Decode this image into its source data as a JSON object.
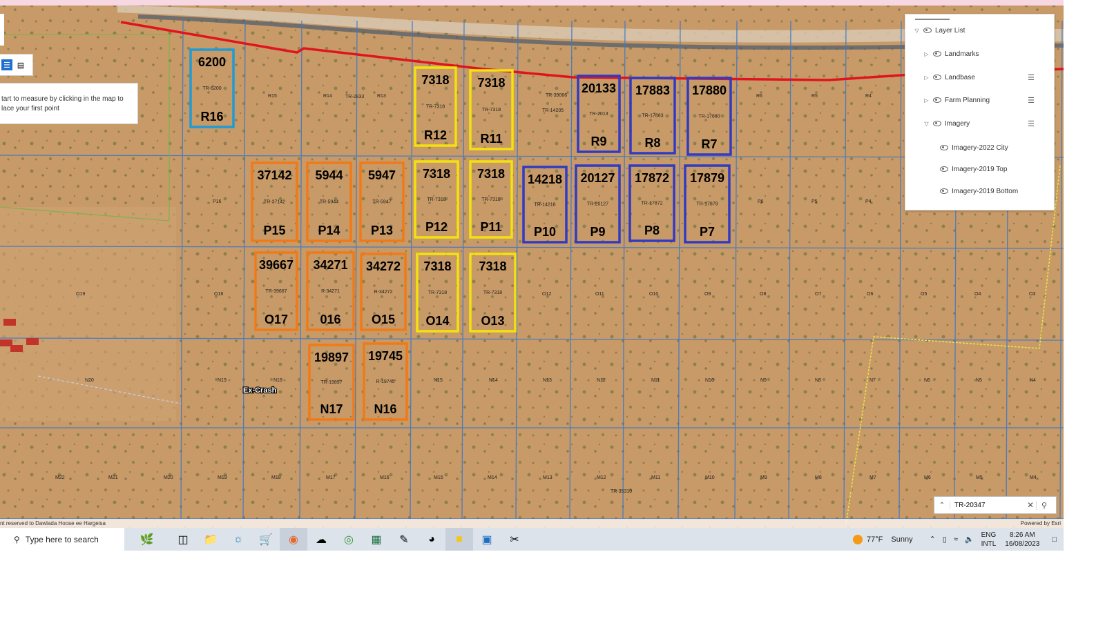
{
  "measure": {
    "hint": "tart to measure by clicking in the map to lace your first point"
  },
  "layer_list": {
    "title": "Layer List",
    "items": [
      {
        "label": "Landmarks",
        "expanded": false
      },
      {
        "label": "Landbase",
        "expanded": false
      },
      {
        "label": "Farm Planning",
        "expanded": false
      },
      {
        "label": "Imagery",
        "expanded": true
      },
      {
        "label": "Imagery-2022 City"
      },
      {
        "label": "Imagery-2019 Top"
      },
      {
        "label": "Imagery-2019 Bottom"
      }
    ]
  },
  "search": {
    "value": "TR-20347"
  },
  "attribution": {
    "left": "nt reserved to Dawlada Hoose ee Hargeisa",
    "right": "Powered by Esri"
  },
  "colors": {
    "yellow": "#f3e20d",
    "orange": "#f07a18",
    "blue": "#2f3bc4",
    "cyan": "#1e9bd6",
    "red_road": "#e0141d"
  },
  "highlighted_plots": [
    {
      "id": "R16",
      "tr": "TR-6200",
      "num": "6200",
      "color": "cyan"
    },
    {
      "id": "R12",
      "tr": "TR-7318",
      "num": "7318",
      "color": "yellow"
    },
    {
      "id": "R11",
      "tr": "TR-7318",
      "num": "7318",
      "color": "yellow"
    },
    {
      "id": "R9",
      "tr": "TR-2013",
      "num": "20133",
      "color": "blue"
    },
    {
      "id": "R8",
      "tr": "TR-17883",
      "num": "17883",
      "color": "blue"
    },
    {
      "id": "R7",
      "tr": "TR-17880",
      "num": "17880",
      "color": "blue"
    },
    {
      "id": "P15",
      "tr": "TR-37142",
      "num": "37142",
      "color": "orange"
    },
    {
      "id": "P14",
      "tr": "TR-5944",
      "num": "5944",
      "color": "orange"
    },
    {
      "id": "P13",
      "tr": "TR-5947",
      "num": "5947",
      "color": "orange"
    },
    {
      "id": "P12",
      "tr": "TR-7318",
      "num": "7318",
      "color": "yellow"
    },
    {
      "id": "P11",
      "tr": "TR-7318",
      "num": "7318",
      "color": "yellow"
    },
    {
      "id": "P10",
      "tr": "TR-14218",
      "num": "14218",
      "color": "blue"
    },
    {
      "id": "P9",
      "tr": "TR-20127",
      "num": "20127",
      "color": "blue"
    },
    {
      "id": "P8",
      "tr": "TR-17872",
      "num": "17872",
      "color": "blue"
    },
    {
      "id": "P7",
      "tr": "TR-17879",
      "num": "17879",
      "color": "blue"
    },
    {
      "id": "O17",
      "tr": "TR-39667",
      "num": "39667",
      "color": "orange"
    },
    {
      "id": "016",
      "tr": "R-34271",
      "num": "34271",
      "color": "orange"
    },
    {
      "id": "O15",
      "tr": "R-34272",
      "num": "34272",
      "color": "orange"
    },
    {
      "id": "O14",
      "tr": "TR-7318",
      "num": "7318",
      "color": "yellow"
    },
    {
      "id": "O13",
      "tr": "TR-7318",
      "num": "7318",
      "color": "yellow"
    },
    {
      "id": "N17",
      "tr": "TR-19897",
      "num": "19897",
      "color": "orange"
    },
    {
      "id": "N16",
      "tr": "R-19745",
      "num": "19745",
      "color": "orange"
    }
  ],
  "grid_labels": {
    "r": [
      "R15",
      "R14",
      "R13",
      "R6",
      "R5",
      "R4"
    ],
    "p": [
      "P16",
      "P6",
      "P5",
      "P4"
    ],
    "o": [
      "O19",
      "O18",
      "O12",
      "O11",
      "O10",
      "O9",
      "O8",
      "O7",
      "O6",
      "O5",
      "O4",
      "O3"
    ],
    "n": [
      "N20",
      "N19",
      "N18",
      "N15",
      "N14",
      "N13",
      "N12",
      "N11",
      "N10",
      "N9",
      "N8",
      "N7",
      "N6",
      "N5",
      "N4"
    ],
    "m": [
      "M22",
      "M21",
      "M20",
      "M19",
      "M18",
      "M17",
      "M16",
      "M15",
      "M14",
      "M13",
      "M12",
      "M11",
      "M10",
      "M9",
      "M8",
      "M7",
      "M6",
      "M5",
      "M4"
    ],
    "tr_small": [
      "TR-2833",
      "TR-39066",
      "TR-14205",
      "TR-35310"
    ]
  },
  "landmark": "Ex-Crash",
  "taskbar": {
    "search_placeholder": "Type here to search",
    "weather_temp": "77°F",
    "weather_text": "Sunny",
    "lang_top": "ENG",
    "lang_bottom": "INTL",
    "time": "8:26 AM",
    "date": "16/08/2023"
  }
}
